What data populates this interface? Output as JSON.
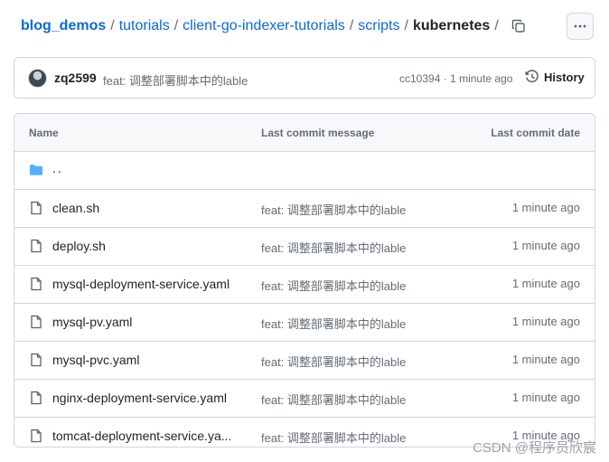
{
  "breadcrumb": {
    "repo": "blog_demos",
    "items": [
      "tutorials",
      "client-go-indexer-tutorials",
      "scripts"
    ],
    "current": "kubernetes",
    "sep": "/"
  },
  "commit": {
    "author": "zq2599",
    "message": "feat: 调整部署脚本中的lable",
    "sha": "cc10394",
    "time": "1 minute ago",
    "history_label": "History"
  },
  "table": {
    "headers": [
      "Name",
      "Last commit message",
      "Last commit date"
    ],
    "parent": "..",
    "rows": [
      {
        "name": "clean.sh",
        "message": "feat: 调整部署脚本中的lable",
        "date": "1 minute ago"
      },
      {
        "name": "deploy.sh",
        "message": "feat: 调整部署脚本中的lable",
        "date": "1 minute ago"
      },
      {
        "name": "mysql-deployment-service.yaml",
        "message": "feat: 调整部署脚本中的lable",
        "date": "1 minute ago"
      },
      {
        "name": "mysql-pv.yaml",
        "message": "feat: 调整部署脚本中的lable",
        "date": "1 minute ago"
      },
      {
        "name": "mysql-pvc.yaml",
        "message": "feat: 调整部署脚本中的lable",
        "date": "1 minute ago"
      },
      {
        "name": "nginx-deployment-service.yaml",
        "message": "feat: 调整部署脚本中的lable",
        "date": "1 minute ago"
      },
      {
        "name": "tomcat-deployment-service.ya...",
        "message": "feat: 调整部署脚本中的lable",
        "date": "1 minute ago"
      }
    ]
  },
  "watermark": "CSDN @程序员欣宸",
  "colors": {
    "link": "#0969da",
    "folder": "#54aeff",
    "muted": "#656d76"
  }
}
